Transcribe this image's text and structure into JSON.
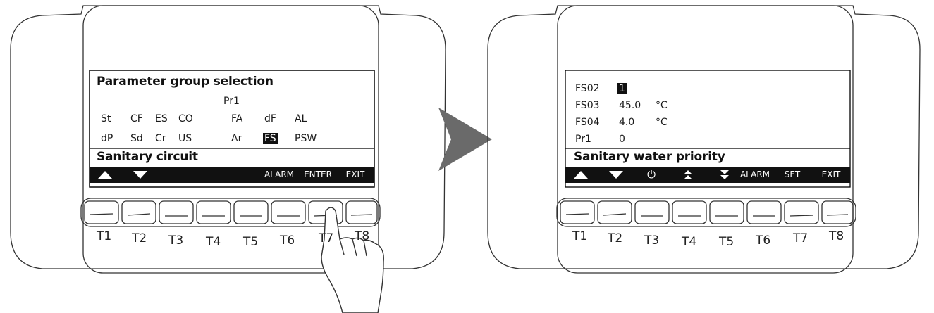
{
  "left_panel": {
    "title": "Parameter group selection",
    "current_group": "Pr1",
    "row1": [
      "St",
      "CF",
      "ES",
      "CO",
      "FA",
      "dF",
      "AL"
    ],
    "row2": [
      "dP",
      "Sd",
      "Cr",
      "US",
      "Ar",
      "FS",
      "PSW"
    ],
    "selected_item": "FS",
    "status": "Sanitary circuit",
    "softkeys": {
      "k1_icon": "up-arrow",
      "k2_icon": "down-arrow",
      "k6": "ALARM",
      "k7": "ENTER",
      "k8": "EXIT"
    },
    "buttons": [
      "T1",
      "T2",
      "T3",
      "T4",
      "T5",
      "T6",
      "T7",
      "T8"
    ]
  },
  "right_panel": {
    "rows": [
      {
        "code": "FS02",
        "value": "1",
        "unit": "",
        "selected": true
      },
      {
        "code": "FS03",
        "value": "45.0",
        "unit": "°C",
        "selected": false
      },
      {
        "code": "FS04",
        "value": "4.0",
        "unit": "°C",
        "selected": false
      },
      {
        "code": "Pr1",
        "value": "0",
        "unit": "",
        "selected": false
      }
    ],
    "status": "Sanitary water priority",
    "softkeys": {
      "k1_icon": "up-arrow",
      "k2_icon": "down-arrow",
      "k3_icon": "power",
      "k4_icon": "double-up",
      "k5_icon": "double-down",
      "k6": "ALARM",
      "k7": "SET",
      "k8": "EXIT"
    },
    "buttons": [
      "T1",
      "T2",
      "T3",
      "T4",
      "T5",
      "T6",
      "T7",
      "T8"
    ]
  },
  "colors": {
    "lcd_bar": "#111111",
    "arrow": "#6a6a6a"
  }
}
